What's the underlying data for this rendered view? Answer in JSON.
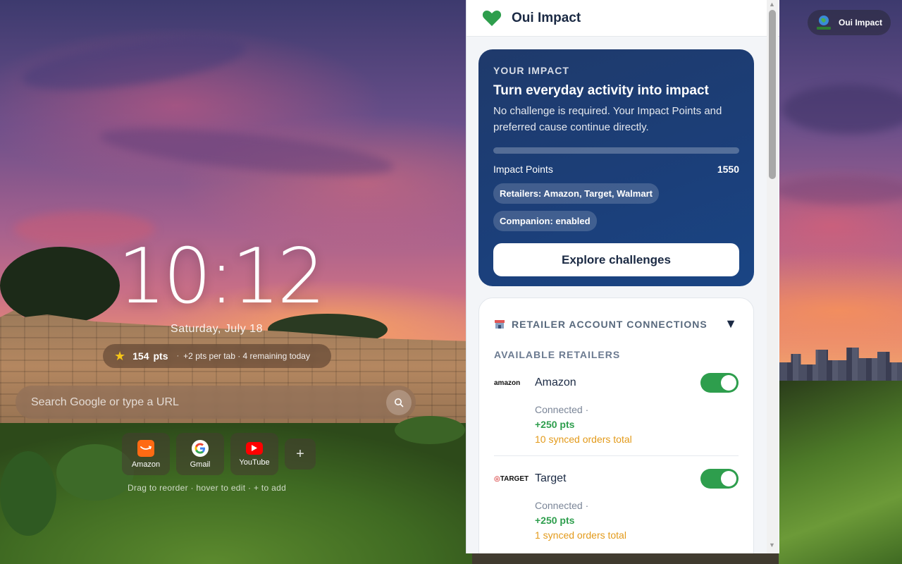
{
  "clock": {
    "time": "10:12",
    "date": "Saturday, July 18"
  },
  "points": {
    "value": "154",
    "unit": "pts",
    "separator": "·",
    "detail": "+2 pts per tab · 4 remaining today"
  },
  "search": {
    "placeholder": "Search Google or type a URL"
  },
  "shortcuts": [
    {
      "label": "Amazon",
      "color": "#ff6a13"
    },
    {
      "label": "Gmail",
      "color": "#ffffff"
    },
    {
      "label": "YouTube",
      "color": "#ff0000"
    }
  ],
  "shortcuts_add": "+",
  "shortcut_hint": "Drag to reorder  ·  hover to edit  ·  + to add",
  "badge": {
    "label": "Oui Impact"
  },
  "panel": {
    "title": "Oui Impact",
    "accent_color": "#2e9e4d",
    "impact": {
      "eyebrow": "YOUR IMPACT",
      "title": "Turn everyday activity into impact",
      "description": "No challenge is required. Your Impact Points and preferred cause continue directly.",
      "points_label": "Impact Points",
      "points_value": "1550",
      "progress": 0.0,
      "chips": [
        "Retailers: Amazon, Target, Walmart",
        "Companion: enabled"
      ],
      "cta": "Explore challenges"
    },
    "retailers": {
      "title": "RETAILER ACCOUNT CONNECTIONS",
      "subtitle": "AVAILABLE RETAILERS",
      "items": [
        {
          "logo": "amazon",
          "name": "Amazon",
          "status": "Connected ·",
          "pts": "+250 pts",
          "orders": "10 synced orders total",
          "enabled": true
        },
        {
          "logo": "TARGET",
          "name": "Target",
          "status": "Connected ·",
          "pts": "+250 pts",
          "orders": "1 synced orders total",
          "enabled": true
        }
      ]
    }
  }
}
